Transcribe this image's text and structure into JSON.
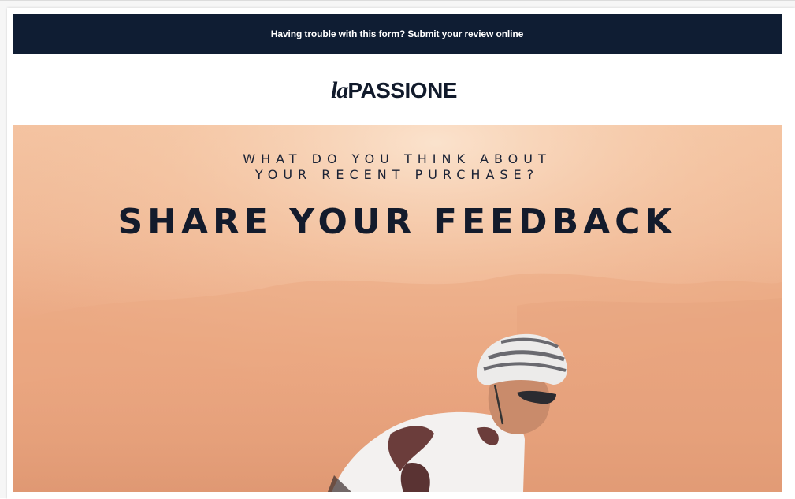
{
  "banner": {
    "link_text": "Having trouble with this form? Submit your review online"
  },
  "logo": {
    "script_part": "la",
    "word_part": "PASSIONE"
  },
  "hero": {
    "kicker_line_1": "WHAT DO YOU THINK ABOUT",
    "kicker_line_2": "YOUR RECENT PURCHASE?",
    "headline": "SHARE YOUR FEEDBACK",
    "image_subject": "cyclist-at-sunset"
  },
  "colors": {
    "banner_bg": "#0f1d33",
    "text_dark": "#131b2c",
    "hero_tone": "#eaa57f"
  }
}
